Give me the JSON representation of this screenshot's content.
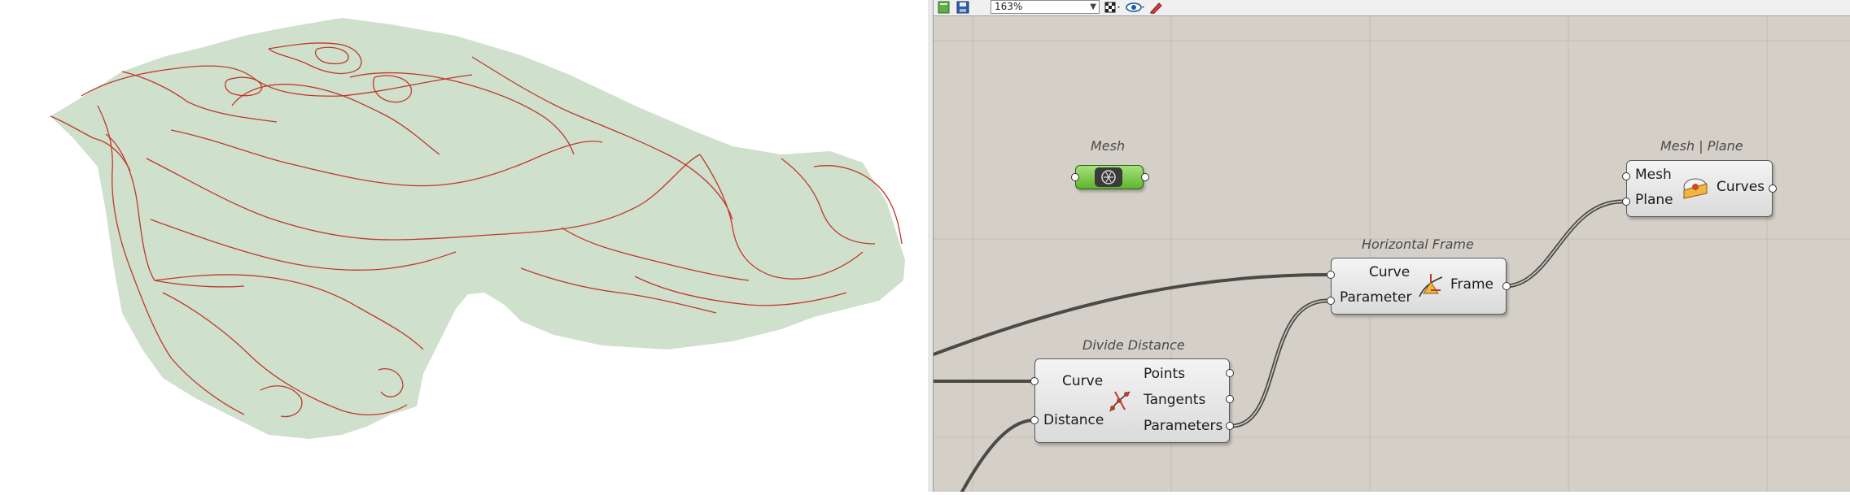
{
  "toolbar": {
    "zoom_level": "163%",
    "icons": [
      "new-document-icon",
      "save-icon",
      "display-mode-icon",
      "preview-eye-icon",
      "sketch-pen-icon"
    ]
  },
  "colors": {
    "terrain_fill": "#cfe0cc",
    "contour_line": "#c0392b",
    "canvas_bg": "#d4d0c8",
    "mesh_param_green": "#6ec43c",
    "wire_dark": "#4a4a46",
    "wire_selected": "#8cd04a"
  },
  "components": {
    "mesh": {
      "title": "Mesh",
      "icon": "mesh-icon"
    },
    "mesh_plane": {
      "title": "Mesh | Plane",
      "inputs": [
        "Mesh",
        "Plane"
      ],
      "outputs": [
        "Curves"
      ],
      "icon": "mesh-plane-intersect-icon"
    },
    "horizontal_frame": {
      "title": "Horizontal Frame",
      "inputs": [
        "Curve",
        "Parameter"
      ],
      "outputs": [
        "Frame"
      ],
      "icon": "horizontal-frame-icon"
    },
    "divide_distance": {
      "title": "Divide Distance",
      "inputs": [
        "Curve",
        "Distance"
      ],
      "outputs": [
        "Points",
        "Tangents",
        "Parameters"
      ],
      "icon": "divide-distance-icon"
    }
  }
}
